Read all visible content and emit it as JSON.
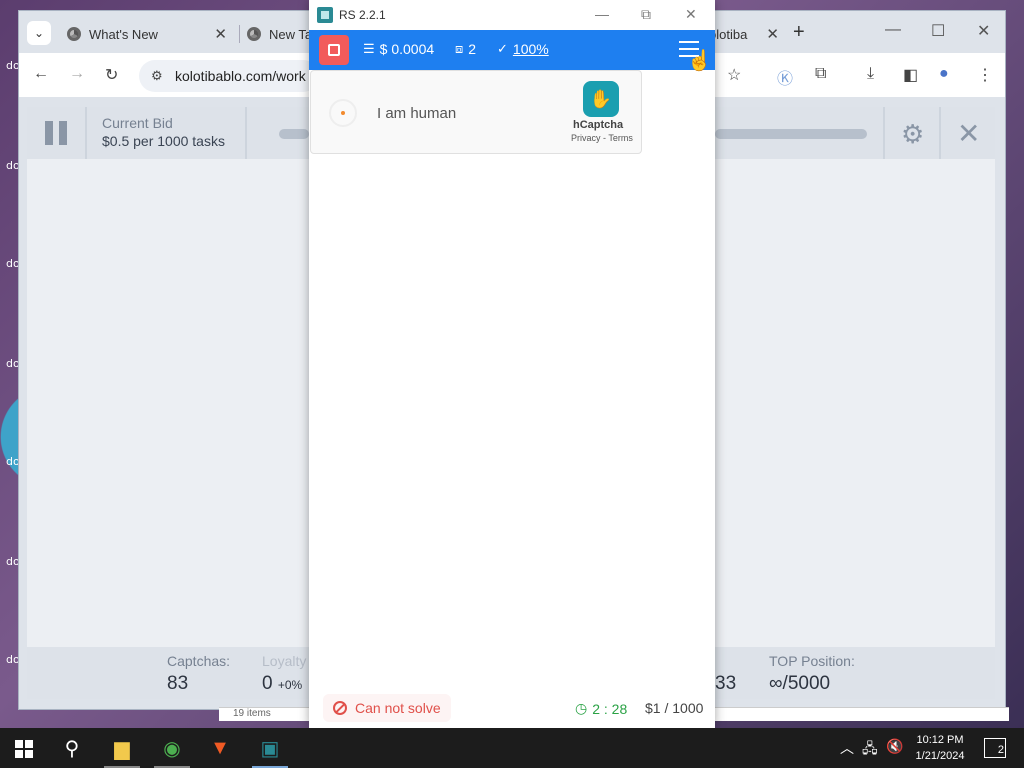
{
  "chrome": {
    "tabs": [
      {
        "title": "What's New"
      },
      {
        "title": "New Ta"
      },
      {
        "title": "olotiba"
      }
    ],
    "address": "kolotibablo.com/work"
  },
  "page": {
    "bid_label": "Current Bid",
    "bid_value": "$0.5 per 1000 tasks",
    "captchas_label": "Captchas:",
    "captchas_value": "83",
    "loyalty_label": "Loyalty",
    "loyalty_value": "0",
    "loyalty_pct": "+0%",
    "partial_value": "33",
    "top_label": "TOP Position:",
    "top_value": "∞/5000",
    "items_text": "19 items"
  },
  "rs": {
    "title": "RS 2.2.1",
    "balance": "$ 0.0004",
    "tasks": "2",
    "success": "100%",
    "captcha_label": "I am human",
    "hcaptcha_name": "hCaptcha",
    "hcaptcha_links": "Privacy - Terms",
    "status": "Can not solve",
    "timer": "2 : 28",
    "rate": "$1 / 1000"
  },
  "taskbar": {
    "time": "10:12 PM",
    "date": "1/21/2024",
    "notifications": "2"
  },
  "desktop": {
    "icon_labels": [
      "do",
      "do",
      "do",
      "do",
      "do",
      "do",
      "do"
    ]
  },
  "colors": {
    "rs_bar": "#1e7ff0",
    "stop": "#f25b5b",
    "error": "#e0504a",
    "timer": "#2aa245"
  }
}
